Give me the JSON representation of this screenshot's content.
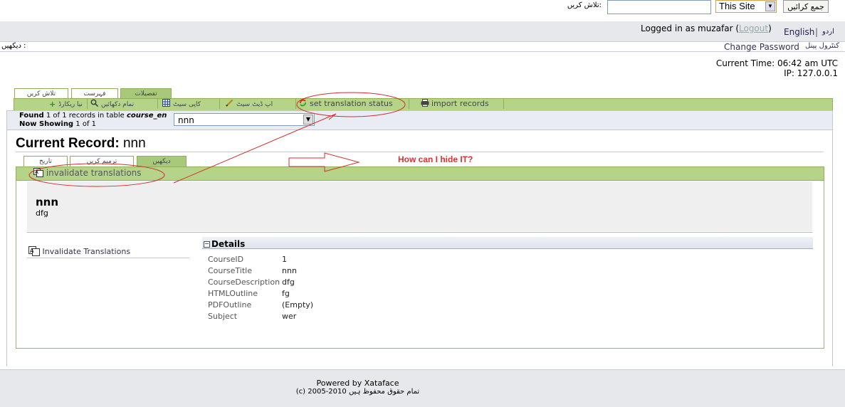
{
  "search": {
    "label": ":تلاش کریں",
    "input_value": "",
    "scope_selected": "This Site",
    "button_label": "جمع کرائیں"
  },
  "user": {
    "logged_in_text": "Logged in as muzafar",
    "logout_label": "Logout",
    "lang_en": "English",
    "lang_sep": "|",
    "lang_ur": "اردو"
  },
  "nav": {
    "breadcrumb": "دیکھیں :",
    "change_password": "Change Password",
    "control_panel": "کنٹرول پینل"
  },
  "status": {
    "current_time": "Current Time: 06:42 am UTC",
    "ip": "IP: 127.0.0.1"
  },
  "main_tabs": [
    {
      "label": "تلاش کریں"
    },
    {
      "label": "فہرست"
    },
    {
      "label": "تفصیلات"
    }
  ],
  "toolbar": {
    "new_record": "نیا ریکارڈ",
    "show_all": "تمام دکھائیں",
    "copy_set": "کاپی سیٹ",
    "update_set": "اپ ڈیٹ سیٹ",
    "set_translation_status": "set translation status",
    "import_records": "import records"
  },
  "results": {
    "found_prefix": "Found",
    "found_text": "1 of 1 records in table",
    "table_name": "course_en",
    "showing_prefix": "Now Showing",
    "showing_text": "1 of 1",
    "record_selected": "nnn"
  },
  "record": {
    "heading_label": "Current Record:",
    "heading_name": "nnn"
  },
  "record_tabs": [
    {
      "label": "تاریخ"
    },
    {
      "label": "ترمیم کریں"
    },
    {
      "label": "دیکھیں"
    }
  ],
  "invalidate_top": "invalidate translations",
  "hero": {
    "title": "nnn",
    "subtitle": "dfg"
  },
  "side": {
    "invalidate_link": "Invalidate Translations"
  },
  "details": {
    "title": "Details",
    "toggle": "−",
    "rows": [
      {
        "label": "CourseID",
        "value": "1"
      },
      {
        "label": "CourseTitle",
        "value": "nnn"
      },
      {
        "label": "CourseDescription",
        "value": "dfg"
      },
      {
        "label": "HTMLOutline",
        "value": "fg"
      },
      {
        "label": "PDFOutline",
        "value": "(Empty)"
      },
      {
        "label": "Subject",
        "value": "wer"
      }
    ]
  },
  "footer": {
    "powered": "Powered by Xataface",
    "copyright": "(c) 2005-2010 تمام حقوق محفوظ ہیں"
  },
  "annotation": {
    "text": "How can I hide IT?",
    "color": "#e03030"
  },
  "colors": {
    "toolbar_green": "#b6d487",
    "tab_active": "#a9c97a",
    "panel_gray": "#e6e8ec"
  }
}
